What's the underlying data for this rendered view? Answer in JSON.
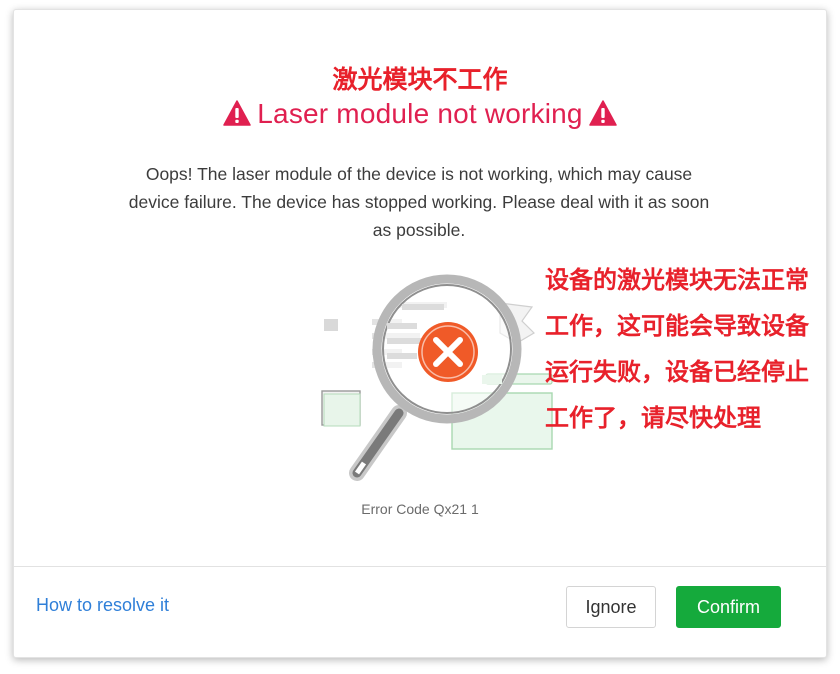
{
  "header": {
    "title_cn": "激光模块不工作",
    "title_en": "Laser module not working"
  },
  "message": "Oops! The laser module of the device is not working, which may cause device failure. The device has stopped working. Please deal with it as soon as possible.",
  "annotation_cn": "设备的激光模块无法正常工作，这可能会导致设备运行失败，设备已经停止工作了，请尽快处理",
  "error_code": "Error Code Qx21 1",
  "footer": {
    "resolve_link": "How to resolve it",
    "ignore_label": "Ignore",
    "confirm_label": "Confirm"
  },
  "icons": {
    "warning": "warning-triangle-icon",
    "illustration": "magnifier-error-illustration"
  },
  "colors": {
    "title_cn": "#e8212b",
    "title_en": "#e02050",
    "link": "#2f7fd8",
    "confirm": "#15aa3c",
    "error_badge": "#f05a28"
  }
}
